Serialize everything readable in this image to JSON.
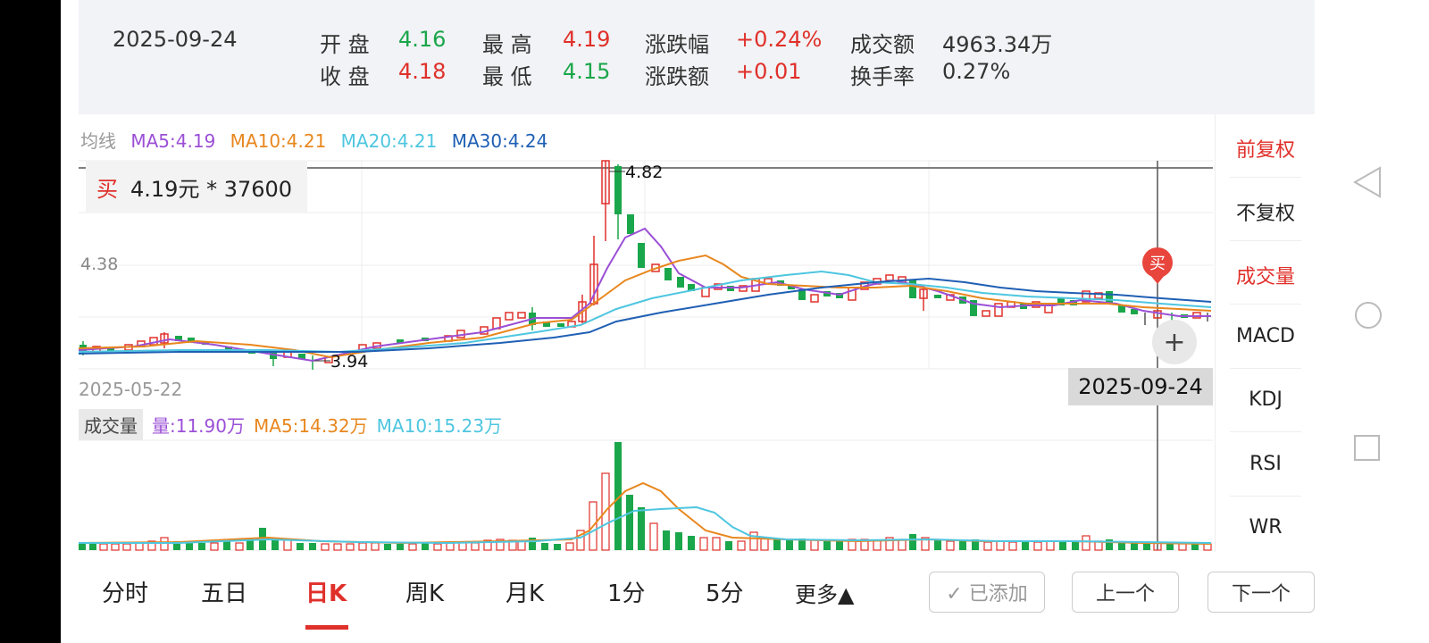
{
  "header": {
    "date": "2025-09-24",
    "open_label": "开 盘",
    "open_value": "4.16",
    "close_label": "收 盘",
    "close_value": "4.18",
    "high_label": "最 高",
    "high_value": "4.19",
    "low_label": "最 低",
    "low_value": "4.15",
    "chg_pct_label": "涨跌幅",
    "chg_pct_value": "+0.24%",
    "chg_amt_label": "涨跌额",
    "chg_amt_value": "+0.01",
    "turnover_amt_label": "成交额",
    "turnover_amt_value": "4963.34万",
    "turnover_rate_label": "换手率",
    "turnover_rate_value": "0.27%"
  },
  "ma_legend": {
    "title": "均线",
    "ma5": "MA5:4.19",
    "ma10": "MA10:4.21",
    "ma20": "MA20:4.21",
    "ma30": "MA30:4.24"
  },
  "buy_box": {
    "tag": "买",
    "text": "4.19元 * 37600"
  },
  "price_axis": {
    "level": "4.38"
  },
  "extremes": {
    "high": "4.82",
    "low": "3.94"
  },
  "dates": {
    "start": "2025-05-22",
    "cursor": "2025-09-24"
  },
  "buy_marker": "买",
  "volume_legend": {
    "tag": "成交量",
    "vol": "量:11.90万",
    "ma5": "MA5:14.32万",
    "ma10": "MA10:15.23万"
  },
  "side_menu": [
    "前复权",
    "不复权",
    "成交量",
    "MACD",
    "KDJ",
    "RSI",
    "WR"
  ],
  "tabs": [
    "分时",
    "五日",
    "日K",
    "周K",
    "月K",
    "1分",
    "5分",
    "更多▲"
  ],
  "buttons": {
    "added": "✓ 已添加",
    "prev": "上一个",
    "next": "下一个"
  },
  "colors": {
    "up": "#e0302a",
    "down": "#1aa64a",
    "ma5": "#9b4fd6",
    "ma10": "#e8871e",
    "ma20": "#4ec6e0",
    "ma30": "#1f5fb4"
  }
}
